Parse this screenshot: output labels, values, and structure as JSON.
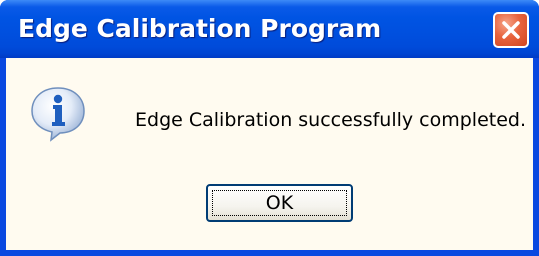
{
  "dialog": {
    "title": "Edge Calibration Program",
    "message": "Edge Calibration successfully completed.",
    "ok_label": "OK",
    "close_icon": "close-icon",
    "message_icon": "information-icon"
  },
  "colors": {
    "titlebar": "#0054e3",
    "client_background": "#fffbf0",
    "close_button": "#e8643e",
    "button_border": "#003c74",
    "info_icon": "#1f5fbf"
  }
}
